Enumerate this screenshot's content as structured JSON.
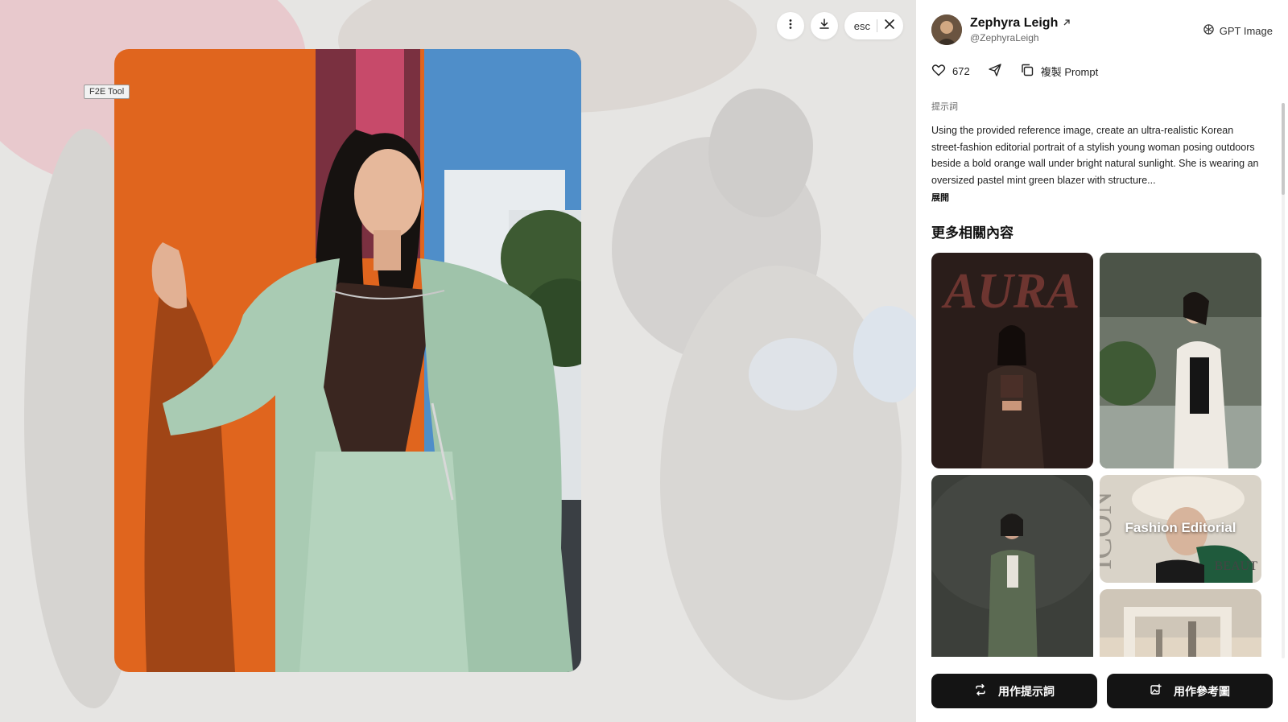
{
  "tool_tag": "F2E Tool",
  "controls": {
    "esc_label": "esc"
  },
  "author": {
    "name": "Zephyra Leigh",
    "handle": "@ZephyraLeigh"
  },
  "model": {
    "label": "GPT Image"
  },
  "actions": {
    "likes": "672",
    "copy_label": "複製 Prompt"
  },
  "prompt": {
    "label": "提示詞",
    "text": "Using the provided reference image, create an ultra-realistic Korean street-fashion editorial portrait of a stylish young woman posing outdoors beside a bold orange wall under bright natural sunlight. She is wearing an oversized pastel mint green blazer with structure...",
    "expand_label": "展開"
  },
  "related": {
    "title": "更多相關內容",
    "card_overlay_text": "AURA",
    "editorial_label": "Fashion Editorial",
    "icon_text": "ICON",
    "beauty_text": "BEAUT"
  },
  "buttons": {
    "use_prompt": "用作提示詞",
    "use_reference": "用作參考圖"
  },
  "colors": {
    "accent": "#141414",
    "wall_orange": "#e0651e",
    "blazer_mint": "#a9cbb3"
  }
}
